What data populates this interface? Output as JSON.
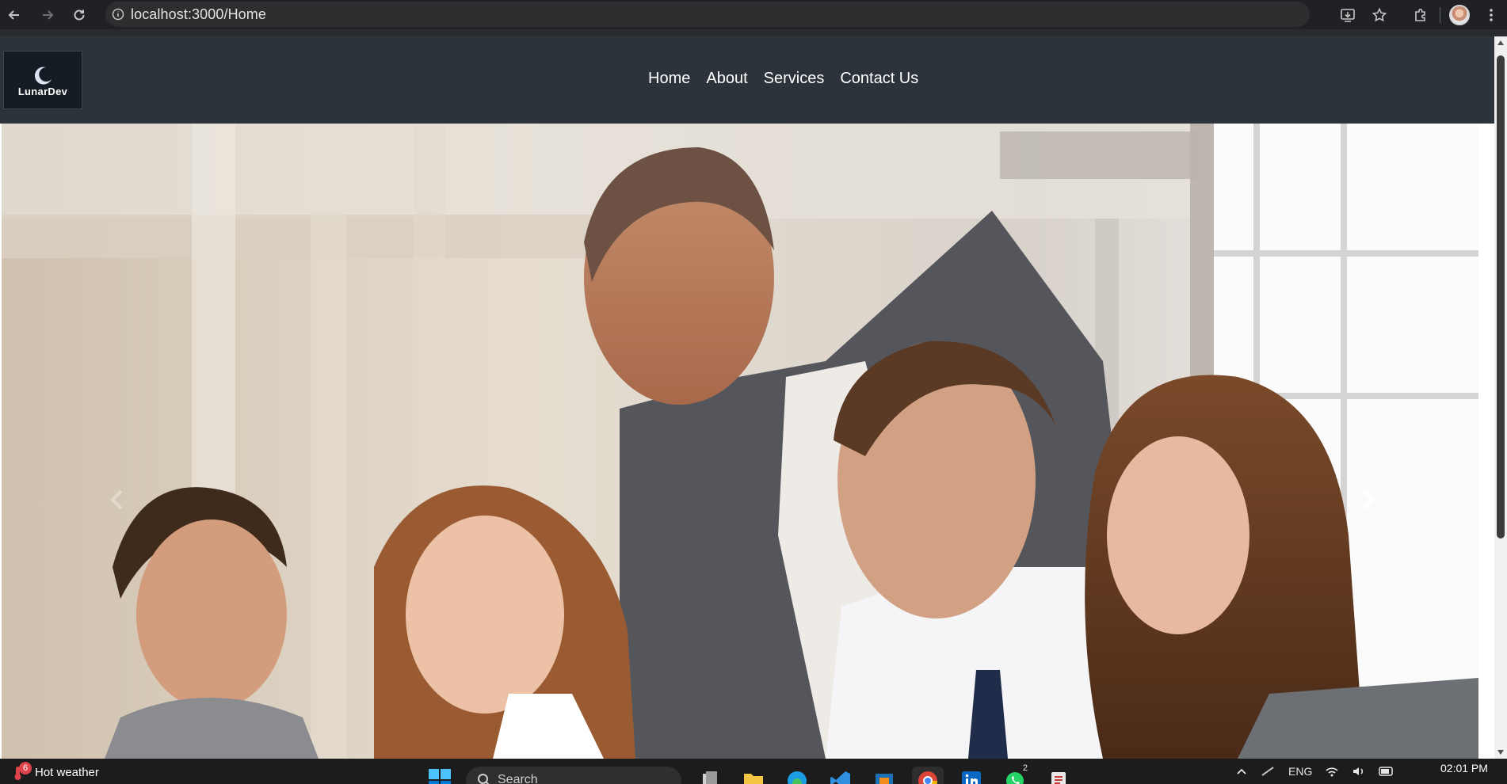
{
  "browser": {
    "url": "localhost:3000/Home"
  },
  "site": {
    "logo_text": "LunarDev",
    "nav": [
      {
        "label": "Home"
      },
      {
        "label": "About"
      },
      {
        "label": "Services"
      },
      {
        "label": "Contact Us"
      }
    ]
  },
  "carousel": {
    "prev_icon": "chevron-left-icon",
    "next_icon": "chevron-right-icon"
  },
  "taskbar": {
    "weather_badge": "6",
    "weather_text": "Hot weather",
    "search_placeholder": "Search",
    "whatsapp_badge": "2",
    "language": "ENG",
    "time": "02:01 PM"
  },
  "colors": {
    "navbar": "#2d333b",
    "chrome": "#202124",
    "taskbar": "#1c1c1c"
  }
}
